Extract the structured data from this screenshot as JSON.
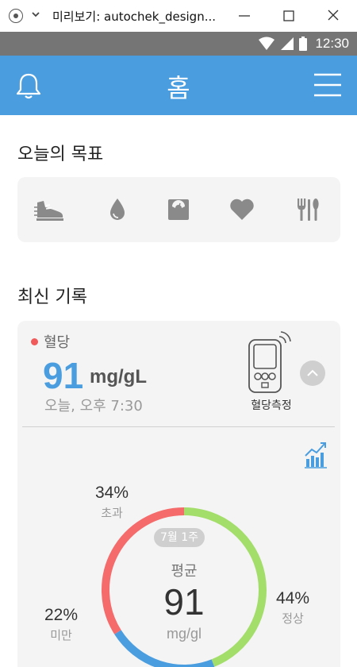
{
  "window": {
    "title": "미리보기: autochek_design..."
  },
  "status_bar": {
    "time": "12:30"
  },
  "header": {
    "title": "홈"
  },
  "goals": {
    "title": "오늘의 목표",
    "items": [
      {
        "icon": "shoe-icon"
      },
      {
        "icon": "water-drop-icon"
      },
      {
        "icon": "scale-icon"
      },
      {
        "icon": "heart-icon"
      },
      {
        "icon": "utensils-icon"
      }
    ]
  },
  "records": {
    "title": "최신 기록",
    "card": {
      "label": "혈당",
      "value": "91",
      "unit": "mg/gL",
      "timestamp": "오늘, 오후 7:30",
      "device_label": "혈당측정"
    },
    "summary": {
      "badge": "7월 1주",
      "caption": "평균",
      "value": "91",
      "unit": "mg/gl",
      "segments": [
        {
          "name": "초과",
          "percent": "34%",
          "value": 34,
          "color": "#f56a6a"
        },
        {
          "name": "정상",
          "percent": "44%",
          "value": 44,
          "color": "#a3dd6a"
        },
        {
          "name": "미만",
          "percent": "22%",
          "value": 22,
          "color": "#4a9ee0"
        }
      ]
    }
  },
  "colors": {
    "accent": "#4a9ee0",
    "over": "#f56a6a",
    "normal": "#a3dd6a",
    "under": "#4a9ee0"
  }
}
